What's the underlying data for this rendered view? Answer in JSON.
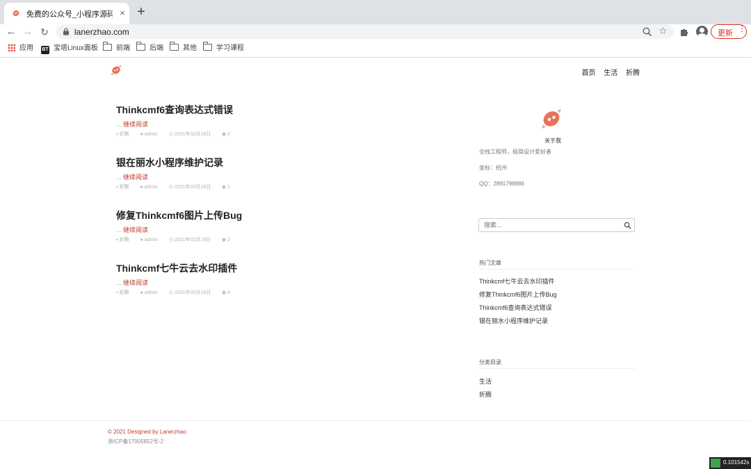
{
  "browser": {
    "tab_title": "免费的公众号_小程序源码网站 \u0010",
    "tab_title_text": "免费的公众号_小程序源码网站 兰",
    "close_glyph": "×",
    "new_tab_glyph": "+",
    "url": "lanerzhao.com",
    "update_label": "更新",
    "update_dots": "⋮",
    "bookmarks": [
      {
        "label": "应用",
        "icon": "apps-grid-icon"
      },
      {
        "label": "宝塔Linux面板",
        "icon": "bt-icon"
      },
      {
        "label": "前端",
        "icon": "folder-icon"
      },
      {
        "label": "后端",
        "icon": "folder-icon"
      },
      {
        "label": "其他",
        "icon": "folder-icon"
      },
      {
        "label": "学习课程",
        "icon": "folder-icon"
      }
    ]
  },
  "site": {
    "nav": [
      "首页",
      "生活",
      "折腾"
    ],
    "posts": [
      {
        "title": "Thinkcmf6查询表达式错误",
        "more": "继续阅读",
        "category": "折腾",
        "author": "admin",
        "date": "2021年02月19日",
        "views": "2"
      },
      {
        "title": "银在丽水小程序维护记录",
        "more": "继续阅读",
        "category": "折腾",
        "author": "admin",
        "date": "2021年02月19日",
        "views": "1"
      },
      {
        "title": "修复Thinkcmf6图片上传Bug",
        "more": "继续阅读",
        "category": "折腾",
        "author": "admin",
        "date": "2021年02月19日",
        "views": "2"
      },
      {
        "title": "Thinkcmf七牛云去水印插件",
        "more": "继续阅读",
        "category": "折腾",
        "author": "admin",
        "date": "2021年02月19日",
        "views": "4"
      }
    ],
    "ellipsis": "...",
    "about": {
      "title": "关于我",
      "lines": [
        "全栈工程师，极简设计爱好者",
        "坐标：杭州",
        "QQ：2891798986"
      ]
    },
    "search_placeholder": "搜索...",
    "hot": {
      "title": "热门文章",
      "items": [
        "Thinkcmf七牛云去水印插件",
        "修复Thinkcmf6图片上传Bug",
        "Thinkcmf6查询表达式错误",
        "银在丽水小程序维护记录"
      ]
    },
    "categories": {
      "title": "分类目录",
      "items": [
        "生活",
        "折腾"
      ]
    },
    "footer": {
      "copyright": "© 2021 Designed by Lanerzhao",
      "icp": "浙ICP备17005852号-2"
    },
    "timing": "0.101542s"
  },
  "colors": {
    "accent": "#c0392b",
    "logo": "#e8735a",
    "update_red": "#d93025"
  }
}
